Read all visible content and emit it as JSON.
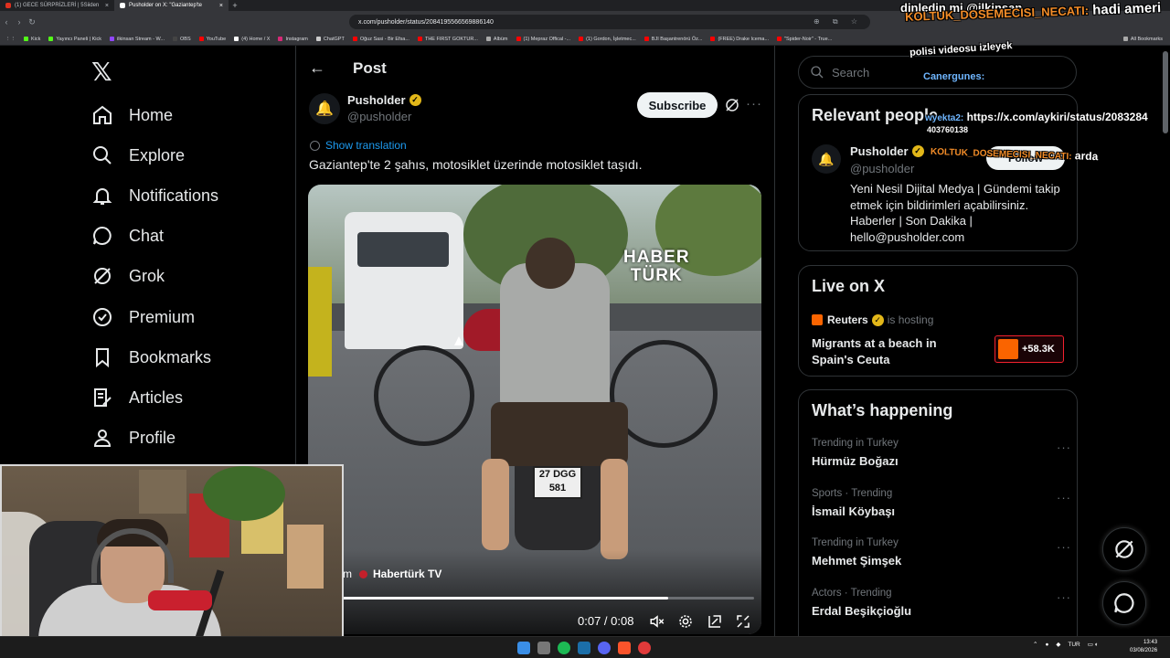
{
  "browser": {
    "tabs": [
      {
        "label": "(1) GECE SÜRPRİZLERİ | 5Siiden",
        "active": false,
        "icon": "kick-icon"
      },
      {
        "label": "Pusholder on X: \"Gaziantep'te",
        "active": true,
        "icon": "x-icon"
      }
    ],
    "url": "x.com/pusholder/status/2084195566569886140",
    "bookmarks": [
      "Kick",
      "Yayıncı Paneli | Kick",
      "ilkinsan Stream - W...",
      "OBS",
      "YouTube",
      "(4) Home / X",
      "Instagram",
      "ChatGPT",
      "Oğuz Sasi - Bir Efsa...",
      "THE FIRST GOKTUR...",
      "Albüm",
      "(1) Mepraz Offical -...",
      "(1) Gordon, İşletmec...",
      "BJI Başantrenörü Öz...",
      "(FREE) Drake Icema...",
      "\"Spider-Noir\" - True..."
    ],
    "all_bookmarks": "All Bookmarks"
  },
  "nav": {
    "items": [
      {
        "label": "Home",
        "icon": "home-icon"
      },
      {
        "label": "Explore",
        "icon": "search-icon"
      },
      {
        "label": "Notifications",
        "icon": "bell-icon"
      },
      {
        "label": "Chat",
        "icon": "chat-icon"
      },
      {
        "label": "Grok",
        "icon": "grok-icon"
      },
      {
        "label": "Premium",
        "icon": "verified-icon"
      },
      {
        "label": "Bookmarks",
        "icon": "bookmark-icon"
      },
      {
        "label": "Articles",
        "icon": "articles-icon"
      },
      {
        "label": "Profile",
        "icon": "profile-icon"
      }
    ]
  },
  "post": {
    "header": "Post",
    "author_name": "Pusholder",
    "author_handle": "@pusholder",
    "subscribe_label": "Subscribe",
    "show_translation": "Show translation",
    "text": "Gaziantep'te 2 şahıs, motosiklet üzerinde motosiklet taşıdı.",
    "video": {
      "watermark_line1": "HABER",
      "watermark_line2": "TÜRK",
      "plate_line1": "27 DGG",
      "plate_line2": "581",
      "attribution_prefix": "m",
      "attribution": "Habertürk TV",
      "time": "0:07 / 0:08",
      "progress": 0.79
    }
  },
  "sidebar": {
    "search_placeholder": "Search",
    "relevant": {
      "title": "Relevant people",
      "name": "Pusholder",
      "handle": "@pusholder",
      "follow_label": "Follow",
      "bio": "Yeni Nesil Dijital Medya | Gündemi takip etmek için bildirimleri açabilirsiniz. Haberler | Son Dakika | hello@pusholder.com"
    },
    "live": {
      "title": "Live on X",
      "host": "Reuters",
      "host_suffix": "is hosting",
      "topic": "Migrants at a beach in Spain's Ceuta",
      "listeners": "+58.3K"
    },
    "happening": {
      "title": "What’s happening",
      "trends": [
        {
          "category": "Trending in Turkey",
          "name": "Hürmüz Boğazı"
        },
        {
          "category": "Sports · Trending",
          "name": "İsmail Köybaşı"
        },
        {
          "category": "Trending in Turkey",
          "name": "Mehmet Şimşek"
        },
        {
          "category": "Actors · Trending",
          "name": "Erdal Beşikçioğlu"
        }
      ]
    }
  },
  "overlay_chat": [
    {
      "user": "",
      "text": "dinledin mi @ilkinsan"
    },
    {
      "user": "KOLTUK_DOSEMECISI_NECATI:",
      "text": "hadi ameri"
    },
    {
      "user": "",
      "text": "polisi videosu izleyek"
    },
    {
      "user": "Canergunes:",
      "text": ""
    },
    {
      "user": "wyekta2:",
      "text": "https://x.com/aykiri/status/2083284"
    },
    {
      "user": "",
      "text": "403760138"
    },
    {
      "user": "KOLTUK_DOSEMECISI_NECATI:",
      "text": "arda"
    }
  ],
  "taskbar": {
    "lang": "TUR",
    "time": "13:43",
    "date": "03/08/2026"
  },
  "colors": {
    "accent": "#1d9bf0",
    "verified": "#e2b719",
    "live_red": "#f4212e",
    "reuters_orange": "#fa6400",
    "chat_user": "#f28c28"
  }
}
